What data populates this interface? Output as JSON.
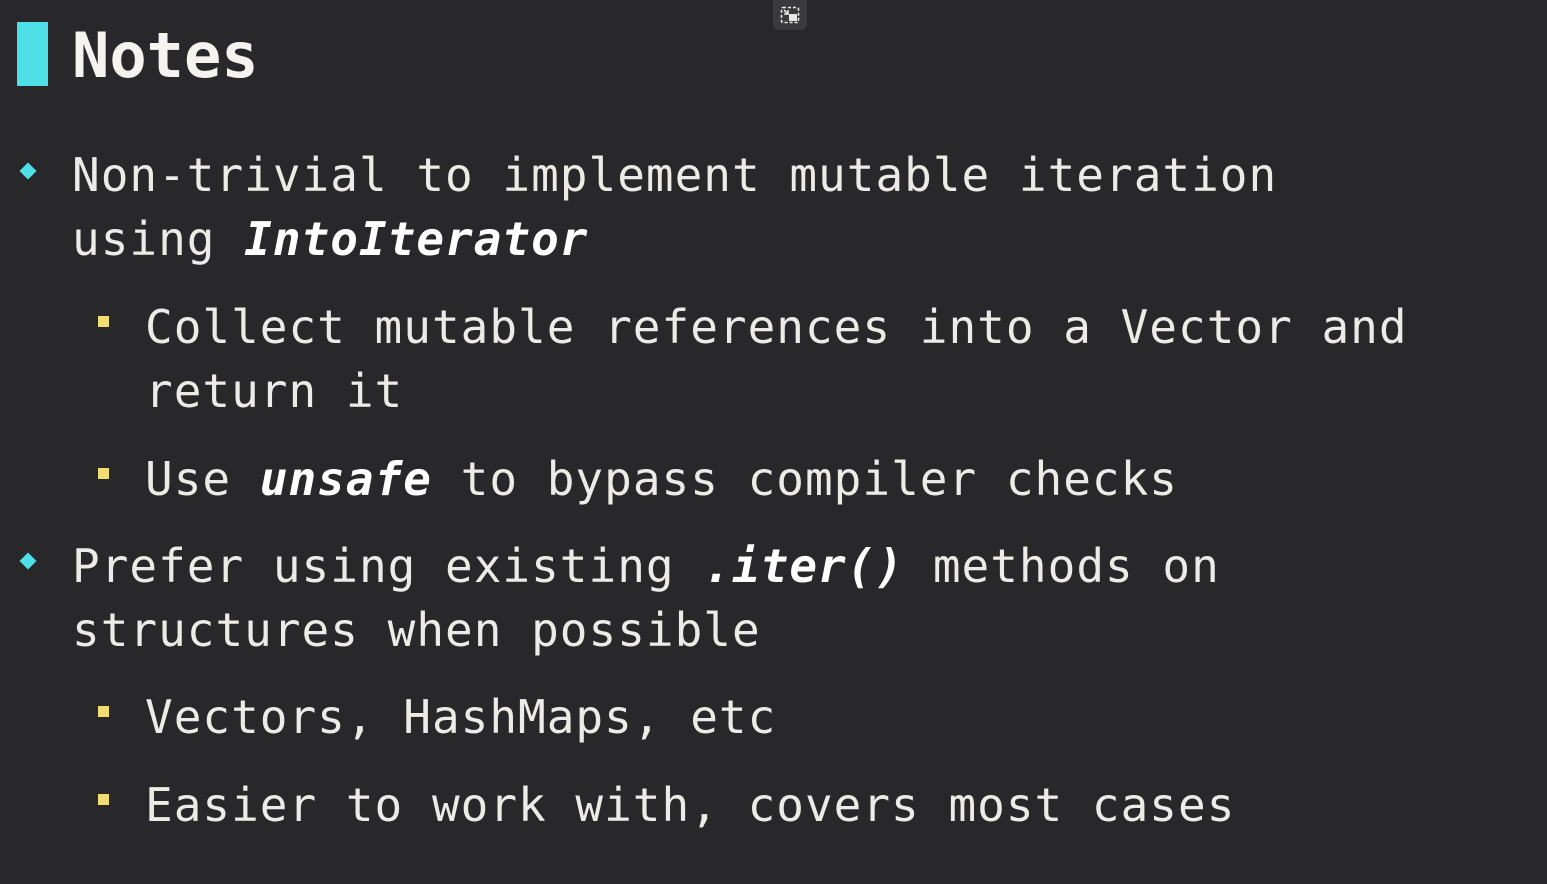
{
  "slide": {
    "title": "Notes"
  },
  "items": {
    "p1": {
      "line1": "Non-trivial to implement mutable iteration",
      "line2_pre": "using ",
      "line2_code": "IntoIterator"
    },
    "p1a": {
      "line1": "Collect mutable references into a Vector and",
      "line2": "return it"
    },
    "p1b": {
      "pre": "Use ",
      "code": "unsafe",
      "post": " to bypass compiler checks"
    },
    "p2": {
      "line1_pre": "Prefer using existing ",
      "line1_code": ".iter()",
      "line1_post": " methods on",
      "line2": "structures when possible"
    },
    "p2a": {
      "text": "Vectors, HashMaps, etc"
    },
    "p2b": {
      "text": "Easier to work with, covers most cases"
    }
  },
  "icons": {
    "exit_fullscreen": "exit-fullscreen-icon",
    "accent": "#4ee0e6",
    "sub_bullet": "#f2dd72",
    "background": "#28272a"
  }
}
